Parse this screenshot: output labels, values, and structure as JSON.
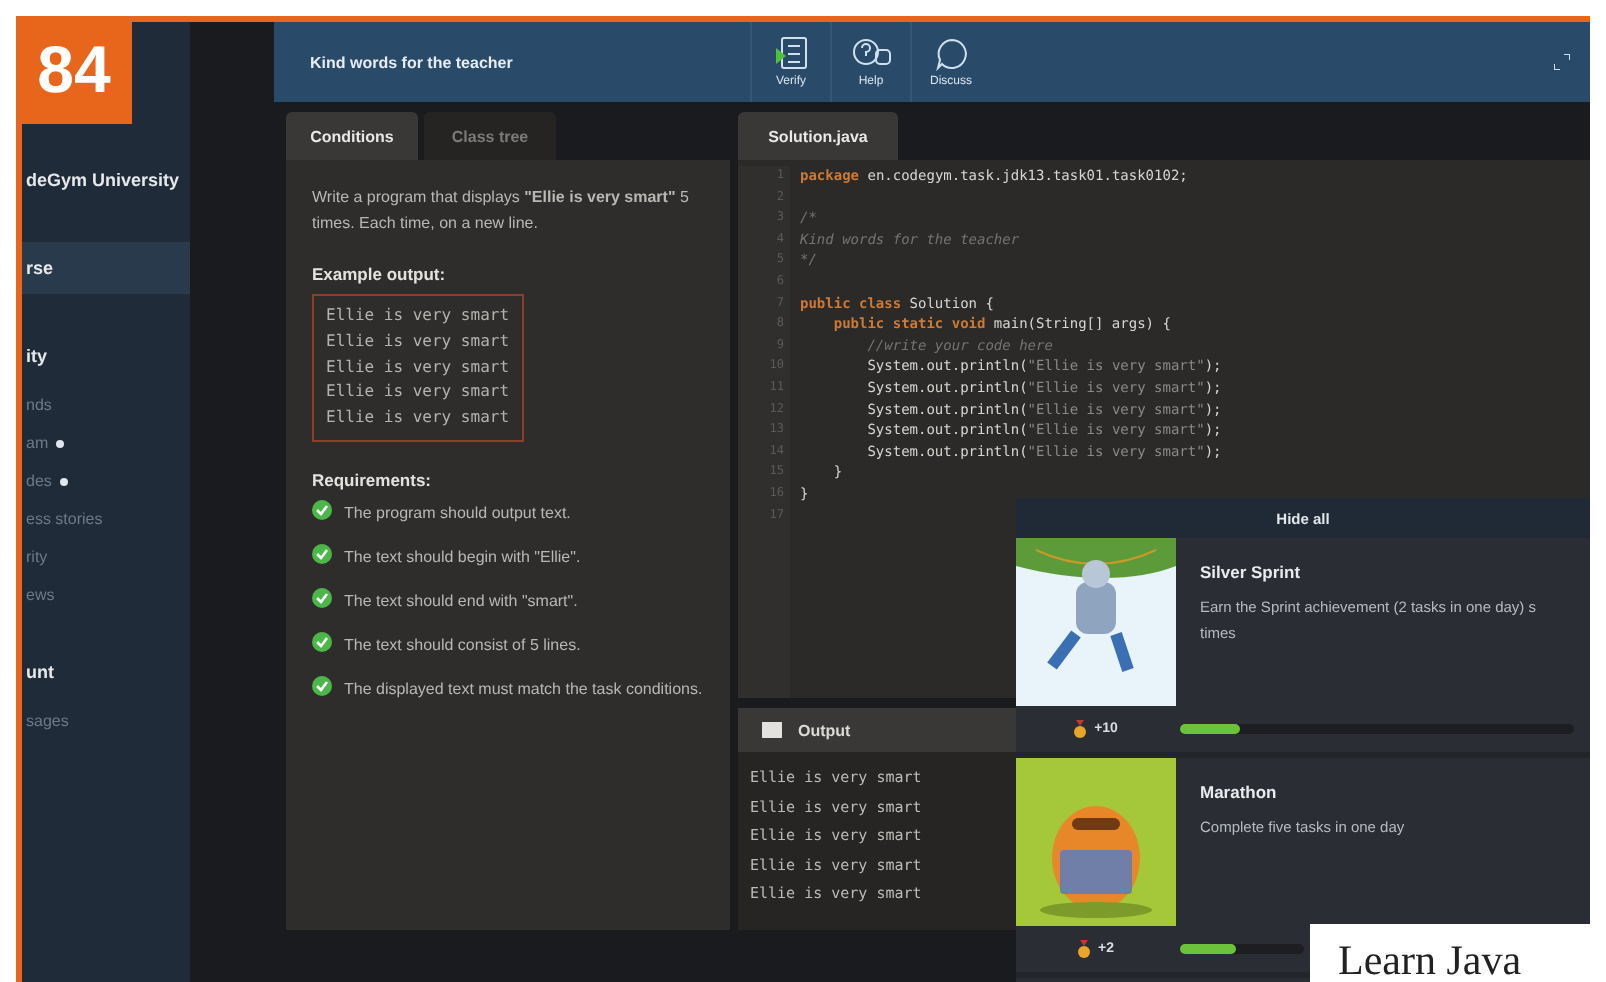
{
  "page_number": "84",
  "caption": "Learn Java",
  "sidebar": [
    {
      "label": "deGym University",
      "kind": "heading",
      "selected": false,
      "dot": false
    },
    {
      "label": "rse",
      "kind": "heading",
      "selected": true,
      "dot": false
    },
    {
      "label": "ity",
      "kind": "heading",
      "selected": false,
      "dot": false
    },
    {
      "label": "nds",
      "kind": "item",
      "selected": false,
      "dot": false
    },
    {
      "label": "am",
      "kind": "item",
      "selected": false,
      "dot": true
    },
    {
      "label": "des",
      "kind": "item",
      "selected": false,
      "dot": true
    },
    {
      "label": "ess stories",
      "kind": "item",
      "selected": false,
      "dot": false
    },
    {
      "label": "rity",
      "kind": "item",
      "selected": false,
      "dot": false
    },
    {
      "label": "ews",
      "kind": "item",
      "selected": false,
      "dot": false
    },
    {
      "label": "unt",
      "kind": "heading",
      "selected": false,
      "dot": false
    },
    {
      "label": "sages",
      "kind": "item",
      "selected": false,
      "dot": false
    }
  ],
  "header": {
    "title": "Kind words for the teacher",
    "tools": [
      {
        "label": "Verify",
        "kind": "verify"
      },
      {
        "label": "Help",
        "kind": "help"
      },
      {
        "label": "Discuss",
        "kind": "discuss"
      }
    ]
  },
  "left_tabs": [
    {
      "label": "Conditions",
      "selected": true
    },
    {
      "label": "Class tree",
      "selected": false
    }
  ],
  "conditions": {
    "intro": "Write a program that displays **\"Ellie is very smart\"** 5 times. Each time, on a new line.",
    "example_title": "Example output:",
    "example": [
      "Ellie is very smart",
      "Ellie is very smart",
      "Ellie is very smart",
      "Ellie is very smart",
      "Ellie is very smart"
    ],
    "requirements_title": "Requirements:",
    "requirements": [
      {
        "text": "The program should output text.",
        "passed": true
      },
      {
        "text": "The text should begin with \"Ellie\".",
        "passed": true
      },
      {
        "text": "The text should end with \"smart\".",
        "passed": true
      },
      {
        "text": "The text should consist of 5 lines.",
        "passed": true
      },
      {
        "text": "The displayed text must match the task conditions.",
        "passed": true
      }
    ]
  },
  "editor": {
    "tab": "Solution.java",
    "lines": [
      {
        "number": "1",
        "parts": [
          {
            "kind": "keyword",
            "text": "package"
          },
          {
            "kind": "plain",
            "text": " en.codegym.task.jdk13.task01.task0102;"
          }
        ]
      },
      {
        "number": "2"
      },
      {
        "number": "3",
        "parts": [
          {
            "kind": "comment",
            "text": "/*"
          }
        ]
      },
      {
        "number": "4",
        "parts": [
          {
            "kind": "comment",
            "text": "Kind words for the teacher"
          }
        ]
      },
      {
        "number": "5",
        "parts": [
          {
            "kind": "comment",
            "text": "*/"
          }
        ]
      },
      {
        "number": "6"
      },
      {
        "number": "7",
        "parts": [
          {
            "kind": "keyword",
            "text": "public class"
          },
          {
            "kind": "plain",
            "text": " Solution {"
          }
        ]
      },
      {
        "number": "8",
        "parts": [
          {
            "kind": "keyword",
            "text": "    public static void"
          },
          {
            "kind": "plain",
            "text": " main(String[] args) {"
          }
        ]
      },
      {
        "number": "9",
        "parts": [
          {
            "kind": "comment",
            "text": "        //write your code here"
          }
        ]
      },
      {
        "number": "10",
        "parts": [
          {
            "kind": "plain",
            "text": "        System.out.println("
          },
          {
            "kind": "string",
            "text": "\"Ellie is very smart\""
          },
          {
            "kind": "plain",
            "text": ");"
          }
        ]
      },
      {
        "number": "11",
        "parts": [
          {
            "kind": "plain",
            "text": "        System.out.println("
          },
          {
            "kind": "string",
            "text": "\"Ellie is very smart\""
          },
          {
            "kind": "plain",
            "text": ");"
          }
        ]
      },
      {
        "number": "12",
        "parts": [
          {
            "kind": "plain",
            "text": "        System.out.println("
          },
          {
            "kind": "string",
            "text": "\"Ellie is very smart\""
          },
          {
            "kind": "plain",
            "text": ");"
          }
        ]
      },
      {
        "number": "13",
        "parts": [
          {
            "kind": "plain",
            "text": "        System.out.println("
          },
          {
            "kind": "string",
            "text": "\"Ellie is very smart\""
          },
          {
            "kind": "plain",
            "text": ");"
          }
        ]
      },
      {
        "number": "14",
        "parts": [
          {
            "kind": "plain",
            "text": "        System.out.println("
          },
          {
            "kind": "string",
            "text": "\"Ellie is very smart\""
          },
          {
            "kind": "plain",
            "text": ");"
          }
        ]
      },
      {
        "number": "15",
        "parts": [
          {
            "kind": "plain",
            "text": "    }"
          }
        ]
      },
      {
        "number": "16",
        "parts": [
          {
            "kind": "plain",
            "text": "}"
          }
        ]
      },
      {
        "number": "17"
      }
    ]
  },
  "output": {
    "title": "Output",
    "lines": [
      "Ellie is very smart",
      "Ellie is very smart",
      "Ellie is very smart",
      "Ellie is very smart",
      "Ellie is very smart"
    ]
  },
  "achievements": {
    "hide_label": "Hide all",
    "items": [
      {
        "title": "Silver Sprint",
        "description": [
          "Earn the Sprint achievement (2 tasks in one day) s",
          "times"
        ],
        "reward": "+10",
        "level": 0.15,
        "kind": "robot"
      },
      {
        "title": "Marathon",
        "description": [
          "Complete five tasks in one day"
        ],
        "reward": "+2",
        "level": 0.45,
        "kind": "monster"
      }
    ]
  }
}
